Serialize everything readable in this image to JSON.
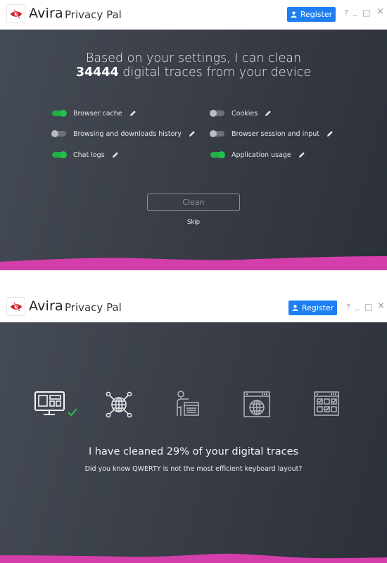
{
  "screens": [
    {
      "titlebar": {
        "brand": "Avira",
        "product": "Privacy Pal",
        "register_label": "Register",
        "controls": [
          "?",
          "_",
          "□",
          "×"
        ]
      },
      "headline": {
        "line1": "Based on your settings, I can clean",
        "count": "34444",
        "line2_rest": " digital traces from your device"
      },
      "options": [
        {
          "label": "Browser cache",
          "enabled": true
        },
        {
          "label": "Browsing and downloads history",
          "enabled": false
        },
        {
          "label": "Chat logs",
          "enabled": true
        },
        {
          "label": "Cookies",
          "enabled": false
        },
        {
          "label": "Browser session and input",
          "enabled": false
        },
        {
          "label": "Application usage",
          "enabled": true
        }
      ],
      "clean_label": "Clean",
      "skip_label": "Skip"
    },
    {
      "titlebar": {
        "brand": "Avira",
        "product": "Privacy Pal",
        "register_label": "Register",
        "controls": [
          "?",
          "_",
          "□",
          "×"
        ]
      },
      "steps": [
        {
          "icon": "computer-dashboard-icon",
          "done": true
        },
        {
          "icon": "network-globe-icon",
          "done": false
        },
        {
          "icon": "user-form-icon",
          "done": false
        },
        {
          "icon": "browser-globe-icon",
          "done": false
        },
        {
          "icon": "checklist-window-icon",
          "done": false
        }
      ],
      "progress_percent": 29,
      "cleaned_text": "I have cleaned 29% of your digital traces",
      "tip_text": "Did you know QWERTY is not the most efficient keyboard layout?"
    }
  ],
  "colors": {
    "accent_blue": "#1e7ff0",
    "toggle_on": "#22c04c",
    "wave_magenta": "#d63cae",
    "check_green": "#2bb24c"
  }
}
